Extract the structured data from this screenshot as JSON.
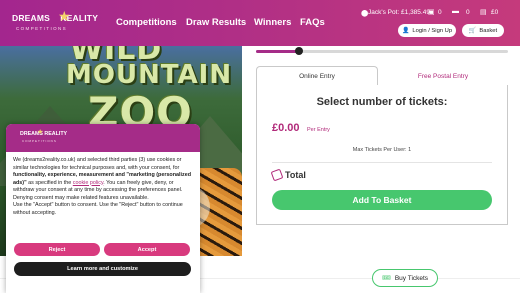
{
  "brand": {
    "logo_text": "DREAMS",
    "logo_mark": "REALITY",
    "logo_sub": "COMPETITIONS"
  },
  "nav": {
    "items": [
      "Competitions",
      "Draw Results",
      "Winners",
      "FAQs"
    ]
  },
  "header": {
    "pot_label": "Jack's Pot: £1,385.49",
    "counter_1": "0",
    "counter_2": "0",
    "counter_3": "£0",
    "login_label": "Login / Sign Up",
    "basket_label": "Basket"
  },
  "hero": {
    "words": [
      "WILD",
      "MOUNTAIN",
      "ZOO"
    ]
  },
  "entry": {
    "tab_online": "Online Entry",
    "tab_postal": "Free Postal Entry",
    "title": "Select number of tickets:",
    "price": "£0.00",
    "per_entry": "Per Entry",
    "max_tickets": "Max Tickets Per User: 1",
    "total_label": "Total",
    "add_button": "Add To Basket",
    "slider_fraction": 0.17
  },
  "footer_bar": {
    "buy_tickets": "Buy Tickets"
  },
  "cookie": {
    "logo_text": "DREAMS REALITY",
    "logo_sub": "COMPETITIONS",
    "text_1": "We (dreams2reality.co.uk) and selected third parties (3) use cookies or similar technologies for technical purposes and, with your consent, for ",
    "text_bold": "functionality, experience, measurement and \"marketing (personalized ads)\"",
    "text_2": " as specified in the ",
    "link": "cookie policy",
    "text_3": ". You can freely give, deny, or withdraw your consent at any time by accessing the preferences panel. Denying consent may make related features unavailable.",
    "text_4": "Use the \"Accept\" button to consent. Use the \"Reject\" button to continue without accepting.",
    "reject": "Reject",
    "accept": "Accept",
    "learn_more": "Learn more and customize"
  },
  "colors": {
    "brand_magenta": "#a52c88",
    "accent_pink": "#d83a7e",
    "cta_green": "#47c76e"
  }
}
